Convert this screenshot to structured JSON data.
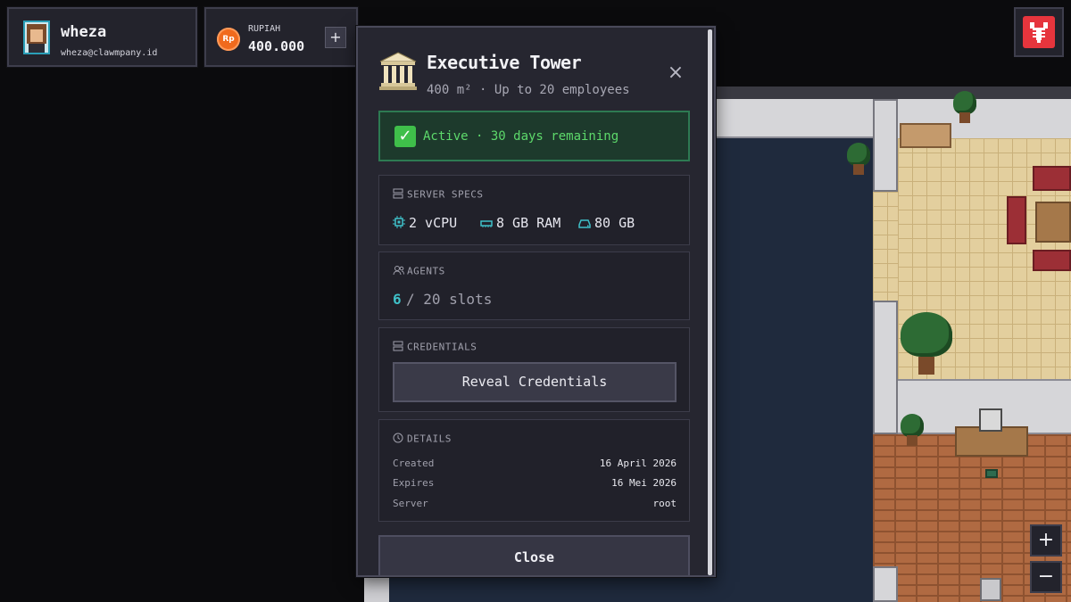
{
  "user": {
    "name": "wheza",
    "email": "wheza@clawmpany.id",
    "avatar_icon": "avatar-icon"
  },
  "wallet": {
    "currency_symbol": "Rp",
    "label": "RUPIAH",
    "amount": "400.000",
    "topup_label": "+"
  },
  "logo": {
    "icon": "lobster-icon",
    "color": "#e6353d"
  },
  "zoom": {
    "in_label": "+",
    "out_label": "−"
  },
  "modal": {
    "icon": "bank-building-icon",
    "title": "Executive Tower",
    "subtitle": "400 m² · Up to 20 employees",
    "close_x": "×",
    "status": {
      "icon": "check-icon",
      "text": "Active · 30 days remaining",
      "color": "#5dd96b"
    },
    "specs": {
      "heading": "SERVER SPECS",
      "cpu": "2 vCPU",
      "ram": "8 GB RAM",
      "disk": "80 GB"
    },
    "agents": {
      "heading": "AGENTS",
      "used": "6",
      "slots": "/ 20 slots",
      "accent": "#3fc1c9"
    },
    "credentials": {
      "heading": "CREDENTIALS",
      "reveal_label": "Reveal Credentials"
    },
    "details": {
      "heading": "DETAILS",
      "rows": [
        {
          "key": "Created",
          "value": "16 April 2026"
        },
        {
          "key": "Expires",
          "value": "16 Mei 2026"
        },
        {
          "key": "Server",
          "value": "root"
        }
      ]
    },
    "close_label": "Close"
  }
}
